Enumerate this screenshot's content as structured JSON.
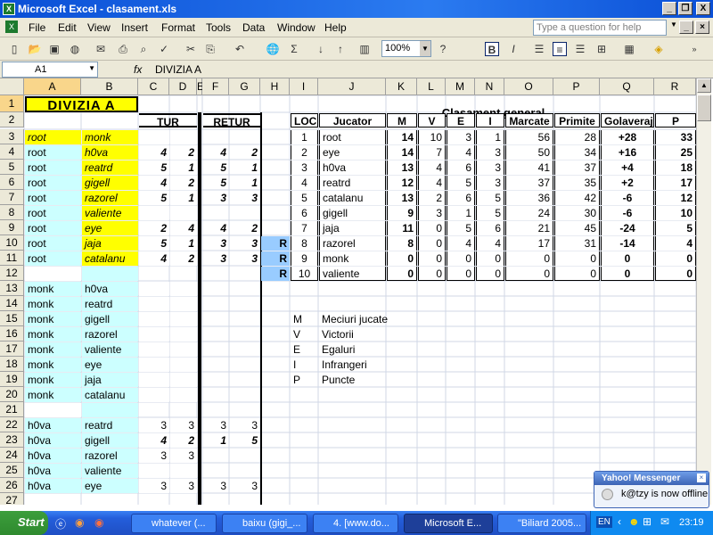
{
  "window": {
    "title": "Microsoft Excel - clasament.xls",
    "app_icon_label": "X",
    "controls": [
      "_",
      "❐",
      "X"
    ]
  },
  "menu": {
    "items": [
      "File",
      "Edit",
      "View",
      "Insert",
      "Format",
      "Tools",
      "Data",
      "Window",
      "Help"
    ],
    "help_placeholder": "Type a question for help"
  },
  "toolbar": {
    "zoom": "100%",
    "bold_label": "B",
    "italic_label": "I"
  },
  "formula_bar": {
    "name_box": "A1",
    "fx": "fx",
    "value": "DIVIZIA A"
  },
  "columns": [
    "A",
    "B",
    "C",
    "D",
    "E",
    "F",
    "G",
    "H",
    "I",
    "J",
    "K",
    "L",
    "M",
    "N",
    "O",
    "P",
    "Q",
    "R"
  ],
  "rows": [
    "1",
    "2",
    "3",
    "4",
    "5",
    "6",
    "7",
    "8",
    "9",
    "10",
    "11",
    "12",
    "13",
    "14",
    "15",
    "16",
    "17",
    "18",
    "19",
    "20",
    "21",
    "22",
    "23",
    "24",
    "25",
    "26",
    "27"
  ],
  "sheet": {
    "title": "DIVIZIA A",
    "tur": "TUR",
    "retur": "RETUR",
    "clasament_title": "Clasament general",
    "standings_headers": [
      "LOC",
      "Jucator",
      "M",
      "V",
      "E",
      "I",
      "Marcate",
      "Primite",
      "Golaveraj",
      "P"
    ],
    "standings": [
      {
        "loc": "1",
        "name": "root",
        "m": "14",
        "v": "10",
        "e": "3",
        "i": "1",
        "marc": "56",
        "prim": "28",
        "gol": "+28",
        "p": "33",
        "r": ""
      },
      {
        "loc": "2",
        "name": "eye",
        "m": "14",
        "v": "7",
        "e": "4",
        "i": "3",
        "marc": "50",
        "prim": "34",
        "gol": "+16",
        "p": "25",
        "r": ""
      },
      {
        "loc": "3",
        "name": "h0va",
        "m": "13",
        "v": "4",
        "e": "6",
        "i": "3",
        "marc": "41",
        "prim": "37",
        "gol": "+4",
        "p": "18",
        "r": ""
      },
      {
        "loc": "4",
        "name": "reatrd",
        "m": "12",
        "v": "4",
        "e": "5",
        "i": "3",
        "marc": "37",
        "prim": "35",
        "gol": "+2",
        "p": "17",
        "r": ""
      },
      {
        "loc": "5",
        "name": "catalanu",
        "m": "13",
        "v": "2",
        "e": "6",
        "i": "5",
        "marc": "36",
        "prim": "42",
        "gol": "-6",
        "p": "12",
        "r": ""
      },
      {
        "loc": "6",
        "name": "gigell",
        "m": "9",
        "v": "3",
        "e": "1",
        "i": "5",
        "marc": "24",
        "prim": "30",
        "gol": "-6",
        "p": "10",
        "r": ""
      },
      {
        "loc": "7",
        "name": "jaja",
        "m": "11",
        "v": "0",
        "e": "5",
        "i": "6",
        "marc": "21",
        "prim": "45",
        "gol": "-24",
        "p": "5",
        "r": ""
      },
      {
        "loc": "8",
        "name": "razorel",
        "m": "8",
        "v": "0",
        "e": "4",
        "i": "4",
        "marc": "17",
        "prim": "31",
        "gol": "-14",
        "p": "4",
        "r": "R"
      },
      {
        "loc": "9",
        "name": "monk",
        "m": "0",
        "v": "0",
        "e": "0",
        "i": "0",
        "marc": "0",
        "prim": "0",
        "gol": "0",
        "p": "0",
        "r": "R"
      },
      {
        "loc": "10",
        "name": "valiente",
        "m": "0",
        "v": "0",
        "e": "0",
        "i": "0",
        "marc": "0",
        "prim": "0",
        "gol": "0",
        "p": "0",
        "r": "R"
      }
    ],
    "legend": [
      {
        "k": "M",
        "v": "Meciuri jucate"
      },
      {
        "k": "V",
        "v": "Victorii"
      },
      {
        "k": "E",
        "v": "Egaluri"
      },
      {
        "k": "I",
        "v": "Infrangeri"
      },
      {
        "k": "P",
        "v": "Puncte"
      }
    ],
    "matches": [
      {
        "row": "3",
        "a": "root",
        "b": "monk",
        "c": "",
        "d": "",
        "f": "",
        "g": "",
        "style": "yi"
      },
      {
        "row": "4",
        "a": "root",
        "b": "h0va",
        "c": "4",
        "d": "2",
        "f": "4",
        "g": "2",
        "style": "ci"
      },
      {
        "row": "5",
        "a": "root",
        "b": "reatrd",
        "c": "5",
        "d": "1",
        "f": "5",
        "g": "1",
        "style": "ci"
      },
      {
        "row": "6",
        "a": "root",
        "b": "gigell",
        "c": "4",
        "d": "2",
        "f": "5",
        "g": "1",
        "style": "ci"
      },
      {
        "row": "7",
        "a": "root",
        "b": "razorel",
        "c": "5",
        "d": "1",
        "f": "3",
        "g": "3",
        "style": "ci"
      },
      {
        "row": "8",
        "a": "root",
        "b": "valiente",
        "c": "",
        "d": "",
        "f": "",
        "g": "",
        "style": "ci"
      },
      {
        "row": "9",
        "a": "root",
        "b": "eye",
        "c": "2",
        "d": "4",
        "f": "4",
        "g": "2",
        "style": "ci"
      },
      {
        "row": "10",
        "a": "root",
        "b": "jaja",
        "c": "5",
        "d": "1",
        "f": "3",
        "g": "3",
        "style": "ci"
      },
      {
        "row": "11",
        "a": "root",
        "b": "catalanu",
        "c": "4",
        "d": "2",
        "f": "3",
        "g": "3",
        "style": "ci"
      },
      {
        "row": "13",
        "a": "monk",
        "b": "h0va",
        "c": "",
        "d": "",
        "f": "",
        "g": "",
        "style": "c"
      },
      {
        "row": "14",
        "a": "monk",
        "b": "reatrd",
        "c": "",
        "d": "",
        "f": "",
        "g": "",
        "style": "c"
      },
      {
        "row": "15",
        "a": "monk",
        "b": "gigell",
        "c": "",
        "d": "",
        "f": "",
        "g": "",
        "style": "c"
      },
      {
        "row": "16",
        "a": "monk",
        "b": "razorel",
        "c": "",
        "d": "",
        "f": "",
        "g": "",
        "style": "c"
      },
      {
        "row": "17",
        "a": "monk",
        "b": "valiente",
        "c": "",
        "d": "",
        "f": "",
        "g": "",
        "style": "c"
      },
      {
        "row": "18",
        "a": "monk",
        "b": "eye",
        "c": "",
        "d": "",
        "f": "",
        "g": "",
        "style": "c"
      },
      {
        "row": "19",
        "a": "monk",
        "b": "jaja",
        "c": "",
        "d": "",
        "f": "",
        "g": "",
        "style": "c"
      },
      {
        "row": "20",
        "a": "monk",
        "b": "catalanu",
        "c": "",
        "d": "",
        "f": "",
        "g": "",
        "style": "c"
      },
      {
        "row": "22",
        "a": "h0va",
        "b": "reatrd",
        "c": "3",
        "d": "3",
        "f": "3",
        "g": "3",
        "style": "c"
      },
      {
        "row": "23",
        "a": "h0va",
        "b": "gigell",
        "c": "4",
        "d": "2",
        "f": "1",
        "g": "5",
        "style": "ci2"
      },
      {
        "row": "24",
        "a": "h0va",
        "b": "razorel",
        "c": "3",
        "d": "3",
        "f": "",
        "g": "",
        "style": "c"
      },
      {
        "row": "25",
        "a": "h0va",
        "b": "valiente",
        "c": "",
        "d": "",
        "f": "",
        "g": "",
        "style": "c"
      },
      {
        "row": "26",
        "a": "h0va",
        "b": "eye",
        "c": "3",
        "d": "3",
        "f": "3",
        "g": "3",
        "style": "c"
      }
    ]
  },
  "taskbar": {
    "start": "Start",
    "tasks": [
      "whatever (...",
      "baixu (gigi_...",
      "4. [www.do...",
      "Microsoft E...",
      "\"Biliard 2005..."
    ],
    "tray_lang": "EN",
    "clock": "23:19"
  },
  "messenger": {
    "title": "Yahoo! Messenger",
    "message": "k@tzy is now offline"
  },
  "colors": {
    "yellow": "#ffff00",
    "cyan": "#ccffff",
    "blue_r": "#99ccff",
    "selected_header": "#f9d68b"
  }
}
